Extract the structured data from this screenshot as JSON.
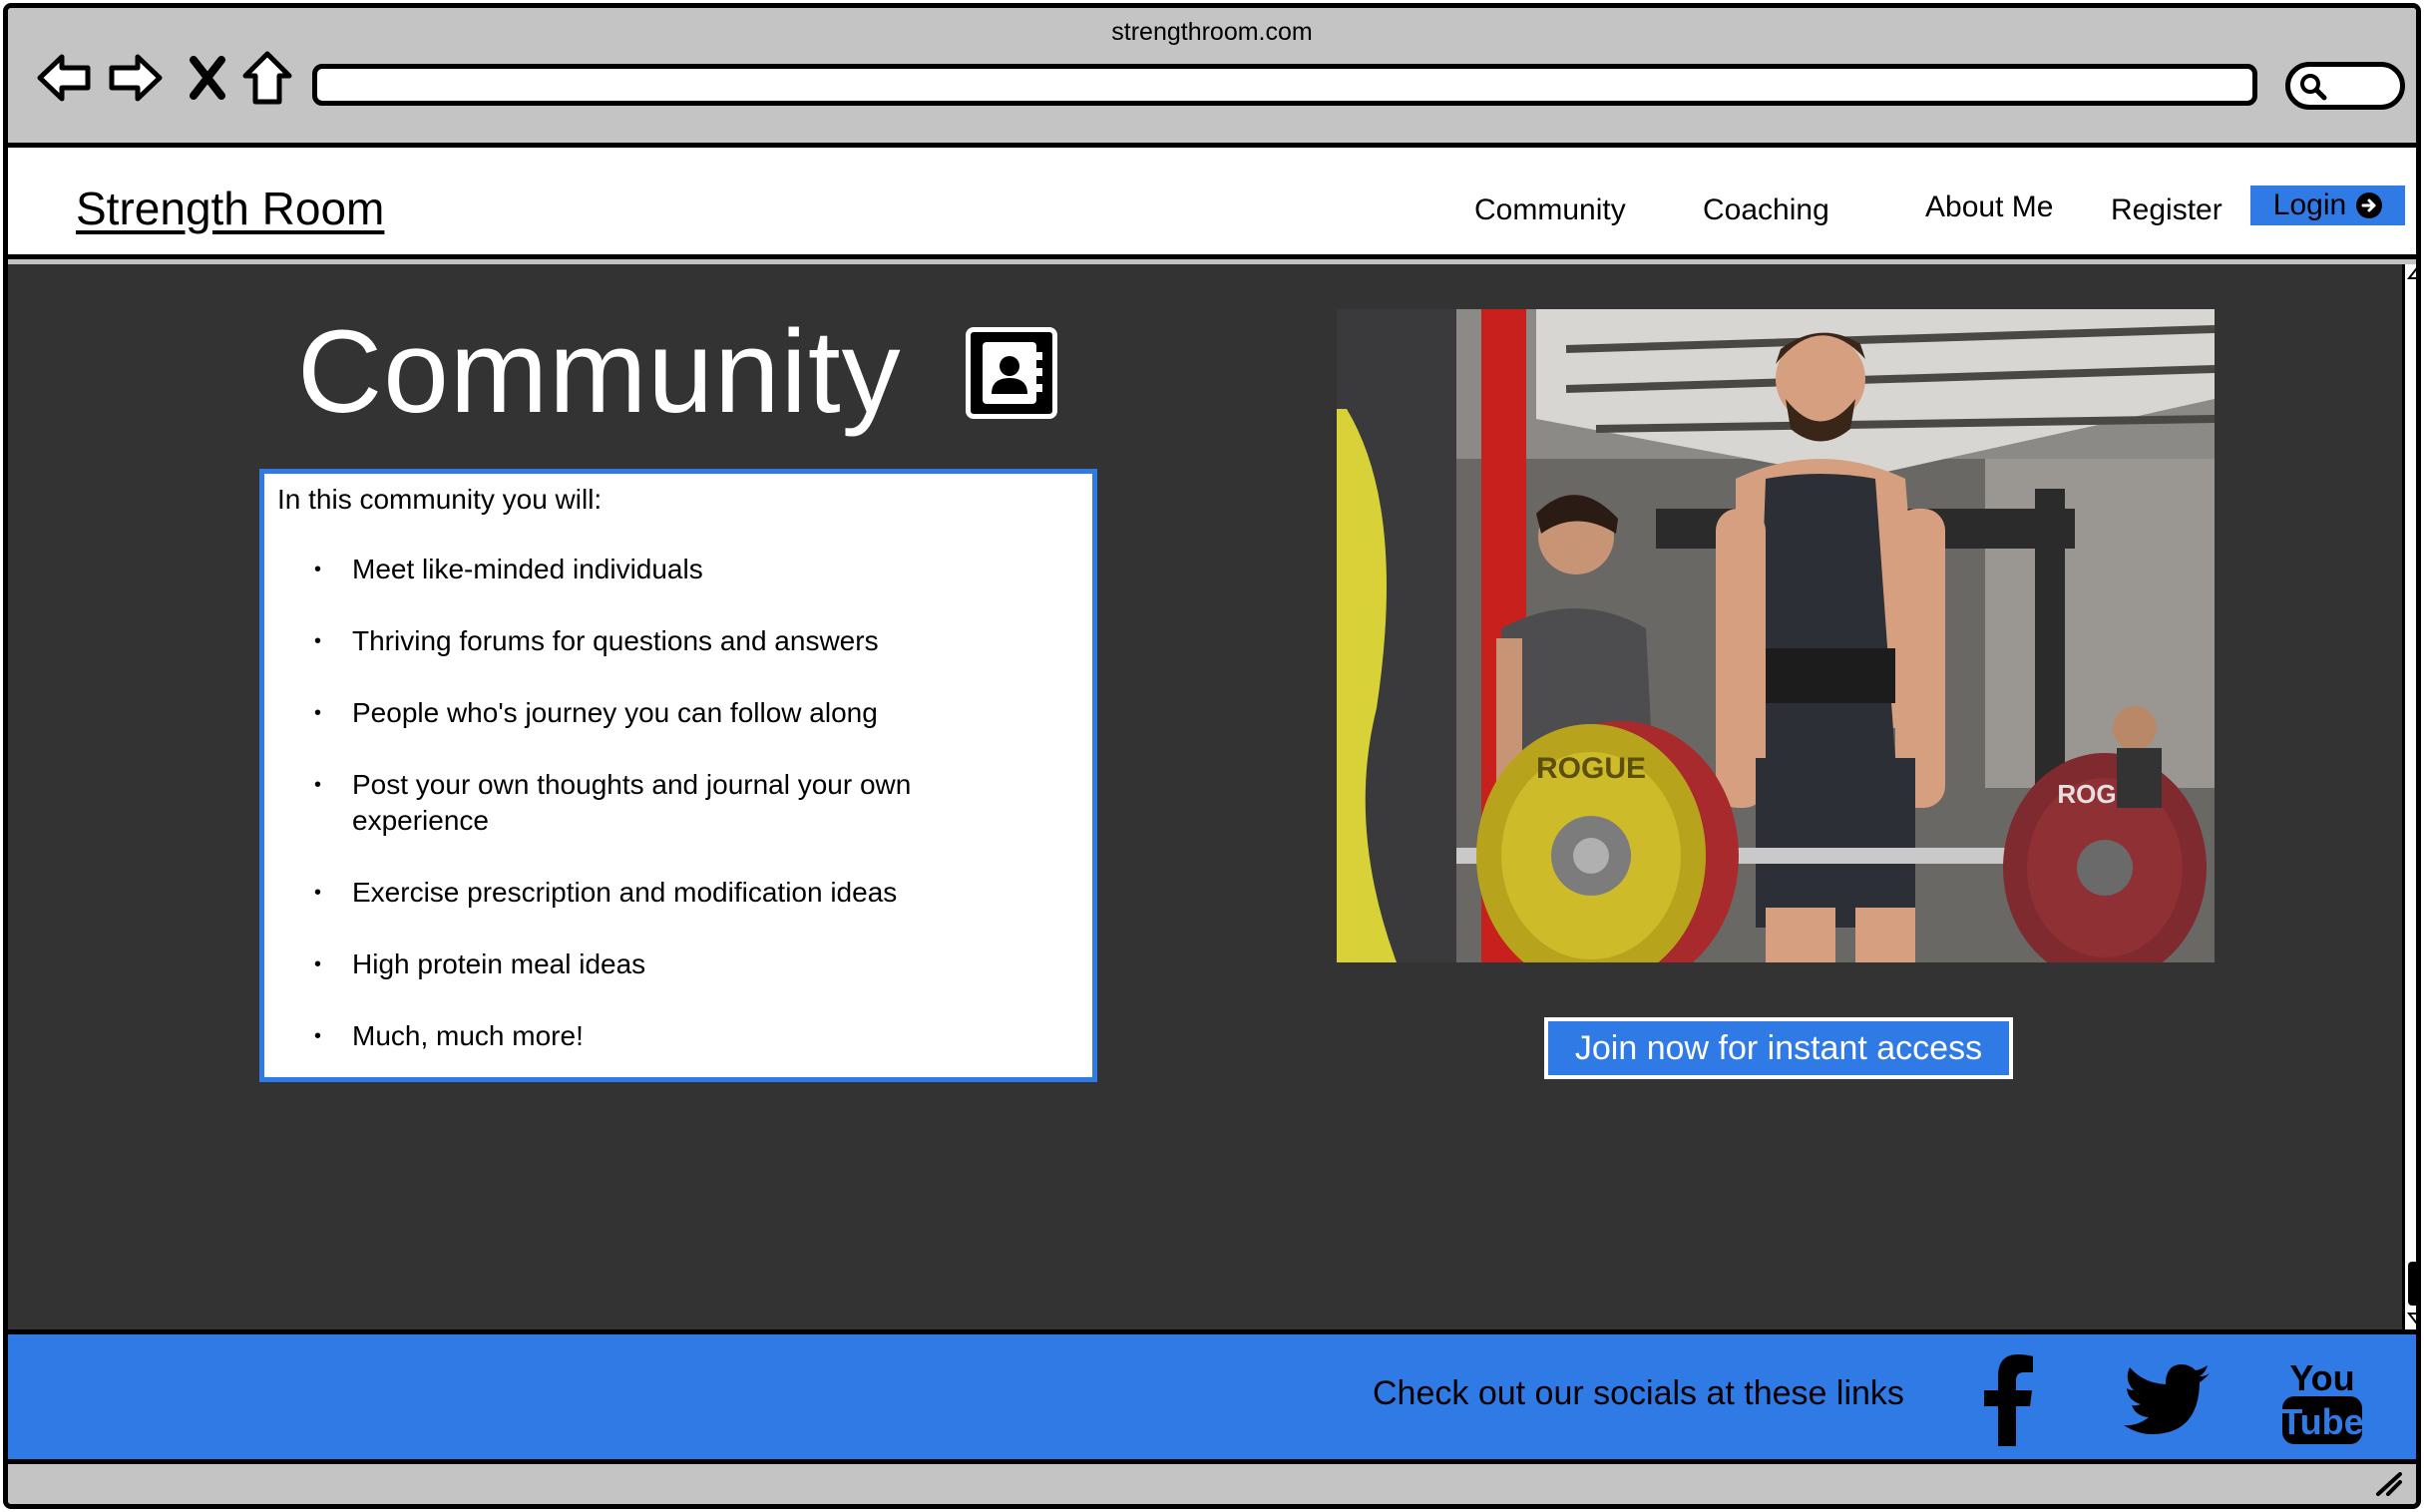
{
  "browser": {
    "title": "strengthroom.com"
  },
  "header": {
    "brand": "Strength Room",
    "nav": [
      "Community",
      "Coaching",
      "About Me",
      "Register"
    ],
    "login_label": "Login"
  },
  "main": {
    "title": "Community",
    "features_intro": "In this community you will:",
    "features": [
      "Meet like-minded individuals",
      "Thriving forums for questions and answers",
      "People who's journey you can follow along",
      "Post your own thoughts and journal your own experience",
      "Exercise prescription and modification ideas",
      "High protein meal ideas",
      "Much, much more!"
    ],
    "photo_text": [
      "ROGUE",
      "ROGUE"
    ],
    "cta_label": "Join now for instant access"
  },
  "footer": {
    "text": "Check out our socials at these links",
    "socials": [
      "facebook-icon",
      "twitter-icon",
      "youtube-icon"
    ],
    "youtube_text": [
      "You",
      "Tube"
    ]
  },
  "colors": {
    "accent": "#2f7ae5",
    "main_bg": "#333333",
    "chrome": "#c4c4c4"
  }
}
